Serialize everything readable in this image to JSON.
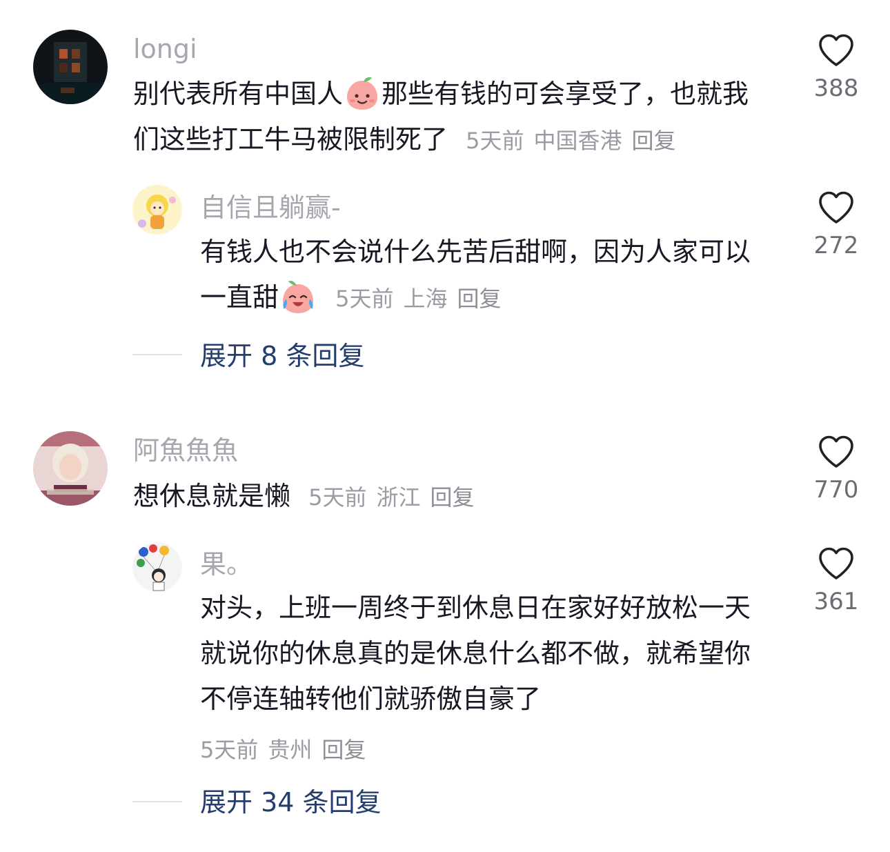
{
  "comments": [
    {
      "username": "longi",
      "text_a": "别代表所有中国人",
      "emoji_a": "smiling-peach-emoji",
      "text_b": "那些有钱的可会享受了，也就我们这些打工牛马被限制死了",
      "time": "5天前",
      "location": "中国香港",
      "reply_label": "回复",
      "likes": "388",
      "reply": {
        "username": "自信且躺赢-",
        "text_a": "有钱人也不会说什么先苦后甜啊，因为人家可以一直甜",
        "emoji_a": "laughing-crying-peach-emoji",
        "time": "5天前",
        "location": "上海",
        "reply_label": "回复",
        "likes": "272"
      },
      "expand_label": "展开 8 条回复"
    },
    {
      "username": "阿魚魚魚",
      "text_a": "想休息就是懒",
      "time": "5天前",
      "location": "浙江",
      "reply_label": "回复",
      "likes": "770",
      "reply": {
        "username": "果。",
        "text_a": "对头，上班一周终于到休息日在家好好放松一天就说你的休息真的是休息什么都不做，就希望你不停连轴转他们就骄傲自豪了",
        "time": "5天前",
        "location": "贵州",
        "reply_label": "回复",
        "likes": "361"
      },
      "expand_label": "展开 34 条回复"
    }
  ],
  "icons": {
    "like": "heart-outline-icon"
  },
  "colors": {
    "username": "#a5a7ae",
    "text": "#161823",
    "meta": "#9a9ca3",
    "expand": "#233e6e"
  }
}
